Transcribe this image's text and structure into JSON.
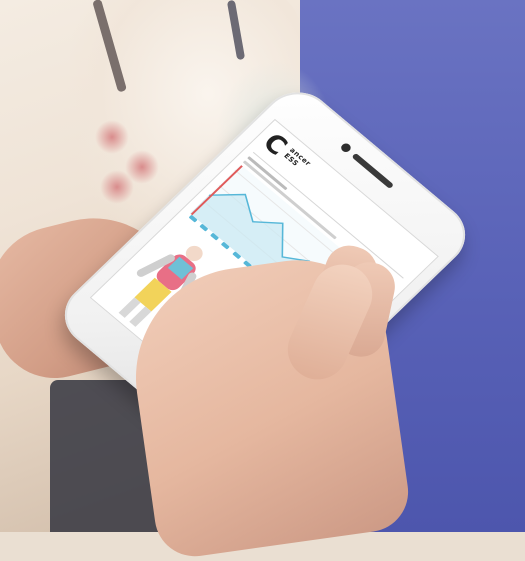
{
  "scene": {
    "subject": "smartphone-in-hand",
    "background_left_color": "#efe3d6",
    "background_right_color": "#5a63b8",
    "phone_color": "#f3f3f3",
    "accent_chart_color": "#56b7d8"
  },
  "phone_screen": {
    "logo_letter": "C",
    "logo_line1": "ancer",
    "logo_line2": "ESS"
  },
  "icons": [
    "home-button-icon",
    "camera-icon",
    "speaker-icon"
  ]
}
